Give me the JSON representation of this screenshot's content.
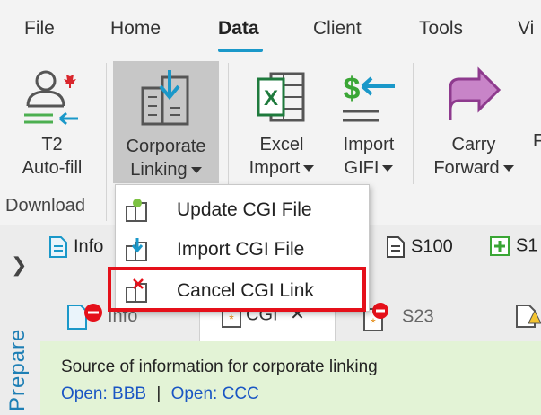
{
  "menubar": {
    "items": [
      "File",
      "Home",
      "Data",
      "Client",
      "Tools",
      "Vi"
    ],
    "active": "Data"
  },
  "ribbon": {
    "t2_autofill": {
      "line1": "T2",
      "line2": "Auto-fill"
    },
    "corporate_linking": {
      "line1": "Corporate",
      "line2": "Linking"
    },
    "excel_import": {
      "line1": "Excel",
      "line2": "Import"
    },
    "import_gifi": {
      "line1": "Import",
      "line2": "GIFI"
    },
    "carry_forward": {
      "line1": "Carry",
      "line2": "Forward"
    },
    "group_download": "Download"
  },
  "dropdown": {
    "items": [
      "Update CGI File",
      "Import CGI File",
      "Cancel CGI Link"
    ],
    "highlighted": "Cancel CGI Link"
  },
  "tabs_row1": [
    "Info",
    "S100",
    "S1"
  ],
  "tabs_row2": [
    "Info",
    "CGI",
    "S23"
  ],
  "active_tab2": "CGI",
  "side": {
    "prepare": "Prepare"
  },
  "info_panel": {
    "heading": "Source of information for corporate linking",
    "link1": "Open: BBB",
    "separator": "|",
    "link2": "Open: CCC"
  },
  "colors": {
    "accent": "#1a98c9",
    "highlight_box": "#e5101a",
    "info_bg": "#e3f3d6",
    "link": "#1a56c4"
  }
}
